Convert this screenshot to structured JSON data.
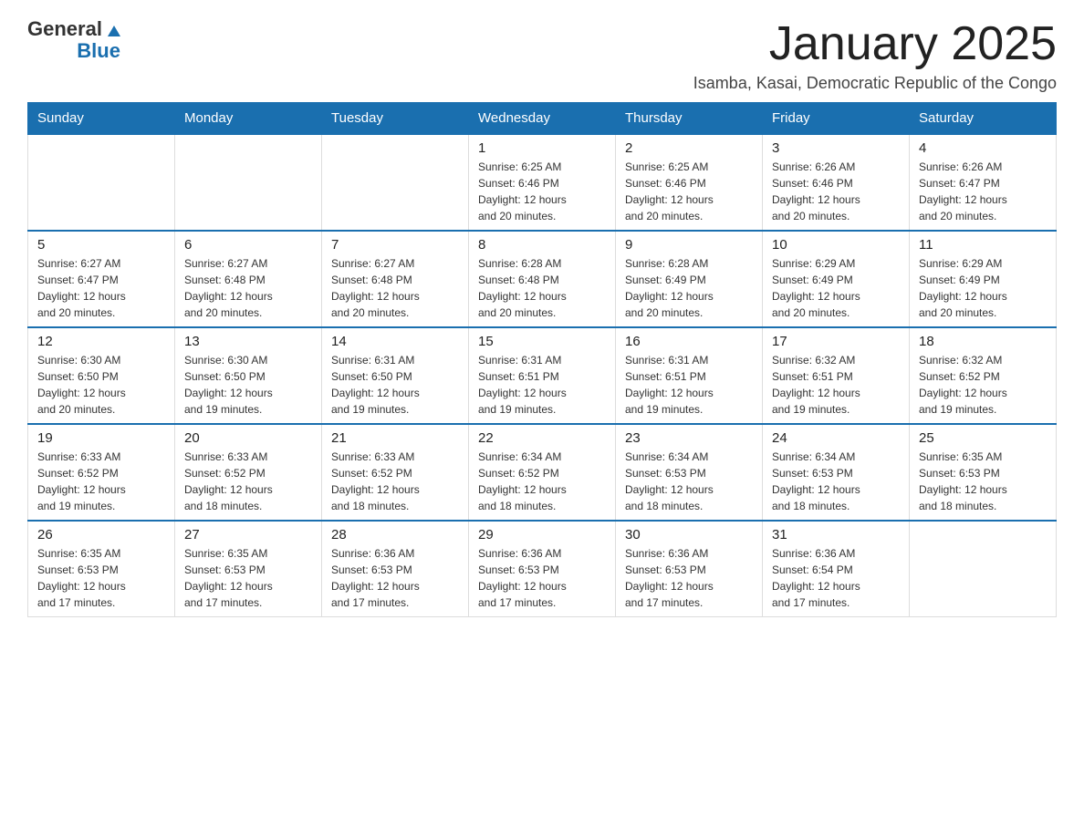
{
  "header": {
    "logo": {
      "text_general": "General",
      "text_blue": "Blue",
      "icon_alt": "GeneralBlue logo triangle"
    },
    "title": "January 2025",
    "subtitle": "Isamba, Kasai, Democratic Republic of the Congo"
  },
  "calendar": {
    "days_of_week": [
      "Sunday",
      "Monday",
      "Tuesday",
      "Wednesday",
      "Thursday",
      "Friday",
      "Saturday"
    ],
    "weeks": [
      [
        {
          "day": "",
          "info": ""
        },
        {
          "day": "",
          "info": ""
        },
        {
          "day": "",
          "info": ""
        },
        {
          "day": "1",
          "info": "Sunrise: 6:25 AM\nSunset: 6:46 PM\nDaylight: 12 hours\nand 20 minutes."
        },
        {
          "day": "2",
          "info": "Sunrise: 6:25 AM\nSunset: 6:46 PM\nDaylight: 12 hours\nand 20 minutes."
        },
        {
          "day": "3",
          "info": "Sunrise: 6:26 AM\nSunset: 6:46 PM\nDaylight: 12 hours\nand 20 minutes."
        },
        {
          "day": "4",
          "info": "Sunrise: 6:26 AM\nSunset: 6:47 PM\nDaylight: 12 hours\nand 20 minutes."
        }
      ],
      [
        {
          "day": "5",
          "info": "Sunrise: 6:27 AM\nSunset: 6:47 PM\nDaylight: 12 hours\nand 20 minutes."
        },
        {
          "day": "6",
          "info": "Sunrise: 6:27 AM\nSunset: 6:48 PM\nDaylight: 12 hours\nand 20 minutes."
        },
        {
          "day": "7",
          "info": "Sunrise: 6:27 AM\nSunset: 6:48 PM\nDaylight: 12 hours\nand 20 minutes."
        },
        {
          "day": "8",
          "info": "Sunrise: 6:28 AM\nSunset: 6:48 PM\nDaylight: 12 hours\nand 20 minutes."
        },
        {
          "day": "9",
          "info": "Sunrise: 6:28 AM\nSunset: 6:49 PM\nDaylight: 12 hours\nand 20 minutes."
        },
        {
          "day": "10",
          "info": "Sunrise: 6:29 AM\nSunset: 6:49 PM\nDaylight: 12 hours\nand 20 minutes."
        },
        {
          "day": "11",
          "info": "Sunrise: 6:29 AM\nSunset: 6:49 PM\nDaylight: 12 hours\nand 20 minutes."
        }
      ],
      [
        {
          "day": "12",
          "info": "Sunrise: 6:30 AM\nSunset: 6:50 PM\nDaylight: 12 hours\nand 20 minutes."
        },
        {
          "day": "13",
          "info": "Sunrise: 6:30 AM\nSunset: 6:50 PM\nDaylight: 12 hours\nand 19 minutes."
        },
        {
          "day": "14",
          "info": "Sunrise: 6:31 AM\nSunset: 6:50 PM\nDaylight: 12 hours\nand 19 minutes."
        },
        {
          "day": "15",
          "info": "Sunrise: 6:31 AM\nSunset: 6:51 PM\nDaylight: 12 hours\nand 19 minutes."
        },
        {
          "day": "16",
          "info": "Sunrise: 6:31 AM\nSunset: 6:51 PM\nDaylight: 12 hours\nand 19 minutes."
        },
        {
          "day": "17",
          "info": "Sunrise: 6:32 AM\nSunset: 6:51 PM\nDaylight: 12 hours\nand 19 minutes."
        },
        {
          "day": "18",
          "info": "Sunrise: 6:32 AM\nSunset: 6:52 PM\nDaylight: 12 hours\nand 19 minutes."
        }
      ],
      [
        {
          "day": "19",
          "info": "Sunrise: 6:33 AM\nSunset: 6:52 PM\nDaylight: 12 hours\nand 19 minutes."
        },
        {
          "day": "20",
          "info": "Sunrise: 6:33 AM\nSunset: 6:52 PM\nDaylight: 12 hours\nand 18 minutes."
        },
        {
          "day": "21",
          "info": "Sunrise: 6:33 AM\nSunset: 6:52 PM\nDaylight: 12 hours\nand 18 minutes."
        },
        {
          "day": "22",
          "info": "Sunrise: 6:34 AM\nSunset: 6:52 PM\nDaylight: 12 hours\nand 18 minutes."
        },
        {
          "day": "23",
          "info": "Sunrise: 6:34 AM\nSunset: 6:53 PM\nDaylight: 12 hours\nand 18 minutes."
        },
        {
          "day": "24",
          "info": "Sunrise: 6:34 AM\nSunset: 6:53 PM\nDaylight: 12 hours\nand 18 minutes."
        },
        {
          "day": "25",
          "info": "Sunrise: 6:35 AM\nSunset: 6:53 PM\nDaylight: 12 hours\nand 18 minutes."
        }
      ],
      [
        {
          "day": "26",
          "info": "Sunrise: 6:35 AM\nSunset: 6:53 PM\nDaylight: 12 hours\nand 17 minutes."
        },
        {
          "day": "27",
          "info": "Sunrise: 6:35 AM\nSunset: 6:53 PM\nDaylight: 12 hours\nand 17 minutes."
        },
        {
          "day": "28",
          "info": "Sunrise: 6:36 AM\nSunset: 6:53 PM\nDaylight: 12 hours\nand 17 minutes."
        },
        {
          "day": "29",
          "info": "Sunrise: 6:36 AM\nSunset: 6:53 PM\nDaylight: 12 hours\nand 17 minutes."
        },
        {
          "day": "30",
          "info": "Sunrise: 6:36 AM\nSunset: 6:53 PM\nDaylight: 12 hours\nand 17 minutes."
        },
        {
          "day": "31",
          "info": "Sunrise: 6:36 AM\nSunset: 6:54 PM\nDaylight: 12 hours\nand 17 minutes."
        },
        {
          "day": "",
          "info": ""
        }
      ]
    ]
  }
}
